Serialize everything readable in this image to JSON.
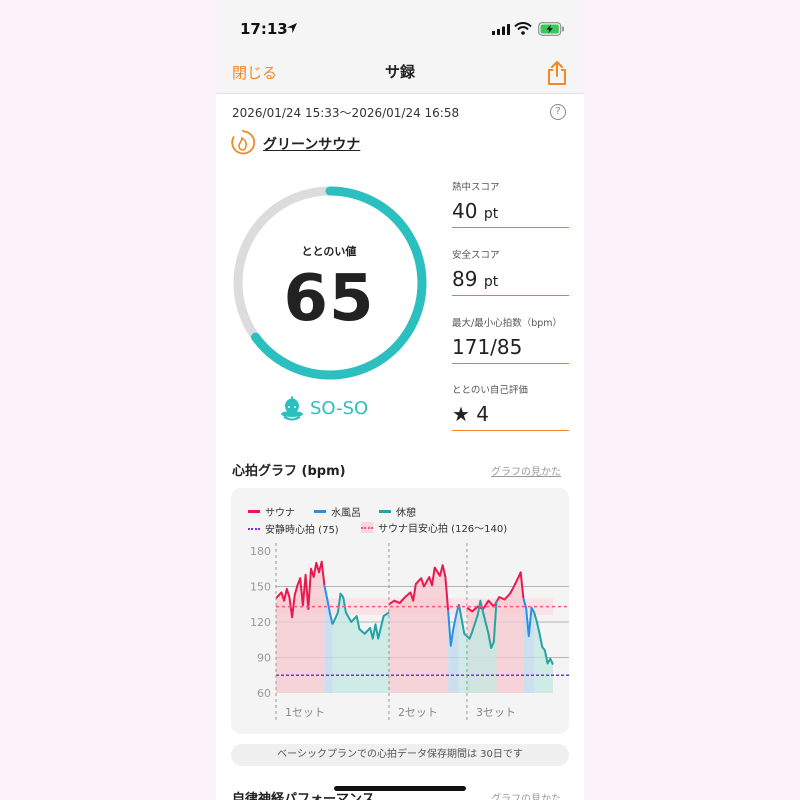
{
  "status": {
    "time": "17:13"
  },
  "nav": {
    "close_label": "閉じる",
    "title": "サ録"
  },
  "session": {
    "date_range": "2026/01/24 15:33〜2026/01/24 16:58",
    "help_label": "?",
    "facility": "グリーンサウナ"
  },
  "gauge": {
    "label": "ととのい値",
    "value": "65",
    "score": 65,
    "max": 100,
    "grade": "SO-SO"
  },
  "scores": [
    {
      "label": "熱中スコア",
      "value": "40",
      "unit": "pt"
    },
    {
      "label": "安全スコア",
      "value": "89",
      "unit": "pt"
    },
    {
      "label": "最大/最小心拍数（bpm）",
      "value": "171/85",
      "unit": ""
    },
    {
      "label": "ととのい自己評価",
      "value": "★ 4",
      "unit": ""
    }
  ],
  "graph_section": {
    "title": "心拍グラフ (bpm)",
    "link": "グラフの見かた"
  },
  "chart_data": {
    "type": "line",
    "legend": [
      {
        "label": "サウナ",
        "color": "#e8194f"
      },
      {
        "label": "水風呂",
        "color": "#2d8fe0"
      },
      {
        "label": "休憩",
        "color": "#25a3a3"
      },
      {
        "label": "安静時心拍 (75)",
        "color": "#7a30e8"
      },
      {
        "label": "サウナ目安心拍 (126〜140)",
        "color": "#f05a7a"
      }
    ],
    "yticks": [
      "180",
      "150",
      "120",
      "90",
      "60"
    ],
    "ylim": [
      60,
      180
    ],
    "resting_hr": 75,
    "target_band": [
      126,
      140
    ],
    "set_labels": [
      "1セット",
      "2セット",
      "3セット"
    ],
    "series": [
      {
        "name": "サウナ",
        "segments": [
          [
            [
              0,
              140
            ],
            [
              2,
              145
            ],
            [
              3,
              138
            ],
            [
              4,
              148
            ],
            [
              5,
              141
            ],
            [
              6,
              124
            ],
            [
              7,
              143
            ],
            [
              8,
              151
            ],
            [
              9,
              157
            ],
            [
              10,
              134
            ],
            [
              11,
              160
            ],
            [
              12,
              131
            ],
            [
              13,
              165
            ],
            [
              14,
              158
            ],
            [
              15,
              170
            ],
            [
              16,
              162
            ],
            [
              17,
              171
            ],
            [
              18,
              151
            ]
          ],
          [
            [
              42,
              135
            ],
            [
              44,
              138
            ],
            [
              46,
              136
            ],
            [
              48,
              141
            ],
            [
              50,
              145
            ],
            [
              51,
              138
            ],
            [
              52,
              152
            ],
            [
              54,
              157
            ],
            [
              55,
              150
            ],
            [
              57,
              158
            ],
            [
              58,
              151
            ],
            [
              59,
              166
            ],
            [
              61,
              159
            ],
            [
              62,
              168
            ],
            [
              63,
              158
            ],
            [
              64,
              130
            ]
          ],
          [
            [
              71,
              132
            ],
            [
              73,
              129
            ],
            [
              75,
              133
            ],
            [
              77,
              131
            ],
            [
              79,
              138
            ],
            [
              81,
              133
            ],
            [
              83,
              141
            ],
            [
              85,
              139
            ],
            [
              87,
              144
            ],
            [
              88,
              148
            ],
            [
              90,
              157
            ],
            [
              91,
              162
            ],
            [
              92,
              140
            ]
          ]
        ]
      },
      {
        "name": "水風呂",
        "segments": [
          [
            [
              18,
              151
            ],
            [
              19,
              140
            ],
            [
              20,
              128
            ],
            [
              21,
              118
            ]
          ],
          [
            [
              64,
              130
            ],
            [
              65,
              100
            ],
            [
              66,
              115
            ],
            [
              67,
              126
            ],
            [
              68,
              135
            ]
          ],
          [
            [
              92,
              140
            ],
            [
              93,
              132
            ],
            [
              94,
              108
            ],
            [
              95,
              132
            ],
            [
              96,
              128
            ]
          ]
        ]
      },
      {
        "name": "休憩",
        "segments": [
          [
            [
              21,
              118
            ],
            [
              23,
              128
            ],
            [
              24,
              144
            ],
            [
              25,
              141
            ],
            [
              26,
              128
            ],
            [
              28,
              120
            ],
            [
              30,
              125
            ],
            [
              31,
              114
            ],
            [
              33,
              110
            ],
            [
              35,
              115
            ],
            [
              36,
              106
            ],
            [
              37,
              118
            ],
            [
              38,
              106
            ],
            [
              40,
              125
            ],
            [
              42,
              128
            ]
          ],
          [
            [
              68,
              135
            ],
            [
              70,
              110
            ],
            [
              72,
              106
            ],
            [
              73,
              112
            ],
            [
              75,
              126
            ],
            [
              76,
              138
            ],
            [
              77,
              128
            ],
            [
              79,
              110
            ],
            [
              80,
              98
            ],
            [
              81,
              103
            ],
            [
              82,
              138
            ]
          ],
          [
            [
              96,
              128
            ],
            [
              97,
              120
            ],
            [
              98,
              110
            ],
            [
              99,
              99
            ],
            [
              100,
              96
            ],
            [
              101,
              85
            ],
            [
              102,
              89
            ],
            [
              103,
              84
            ]
          ]
        ]
      }
    ]
  },
  "storage_note": "ベーシックプランでの心拍データ保存期間は 30日です",
  "next_section": {
    "title": "自律神経パフォーマンス",
    "link": "グラフの見かた"
  }
}
